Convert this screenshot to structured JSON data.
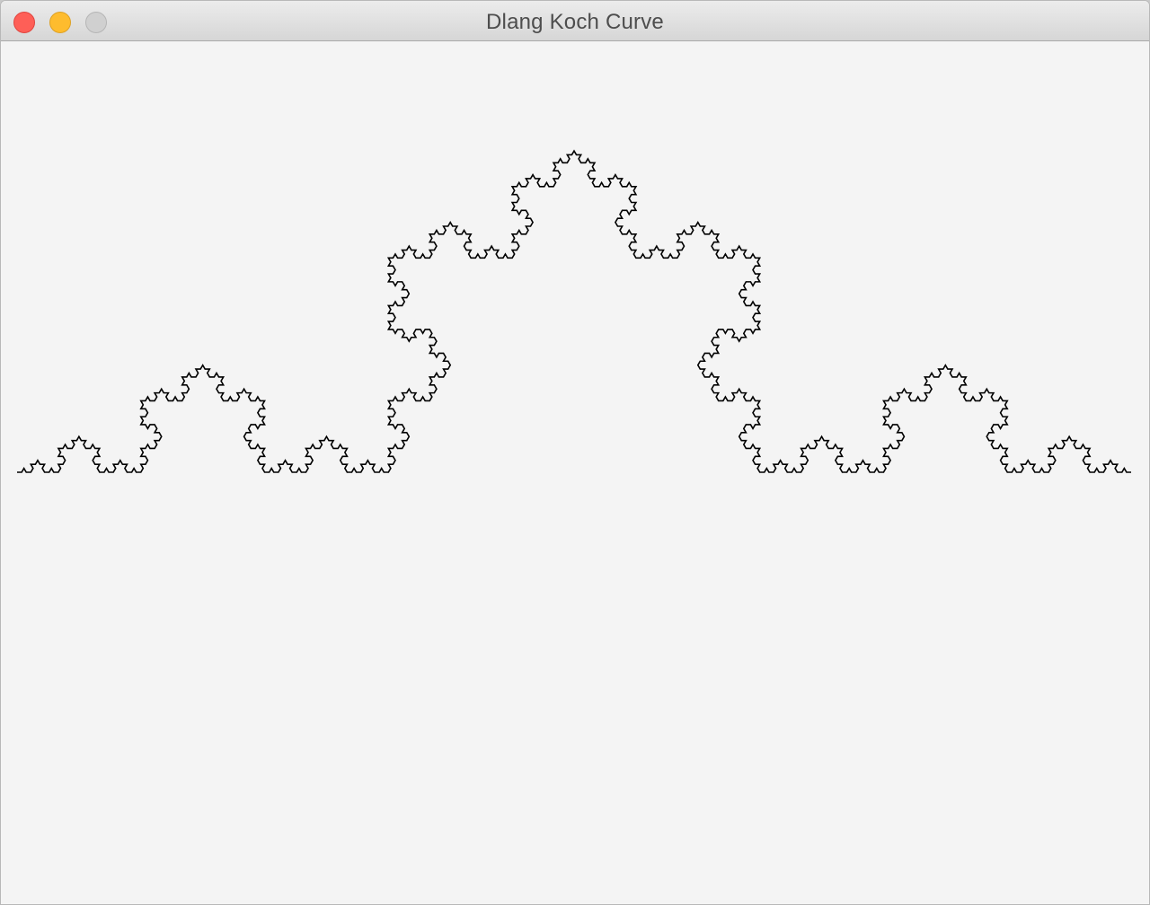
{
  "window": {
    "title": "Dlang Koch Curve"
  },
  "colors": {
    "curve": "#000000",
    "background": "#f4f4f4"
  },
  "icons": {
    "close": "close-icon",
    "minimize": "minimize-icon",
    "zoom": "zoom-icon"
  }
}
